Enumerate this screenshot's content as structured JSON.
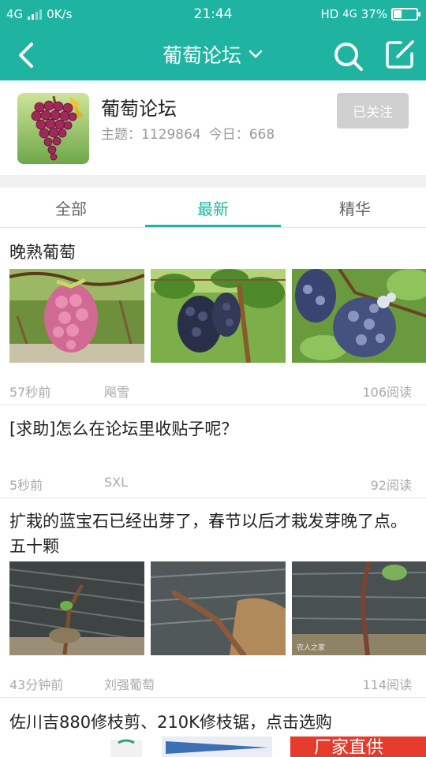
{
  "status_bar": {
    "carrier": "4G",
    "speed": "0K/s",
    "time": "21:44",
    "hd": "HD",
    "network": "4G",
    "battery": "37%",
    "battery_level": 0.37
  },
  "app_bar": {
    "title": "葡萄论坛",
    "icons": [
      "back-icon",
      "chevron-down-icon",
      "search-icon",
      "compose-icon"
    ]
  },
  "forum": {
    "name": "葡萄论坛",
    "topics_label": "主题：1129864",
    "today_label": "今日：668",
    "follow_label": "已关注"
  },
  "tabs": [
    {
      "label": "全部",
      "active": false
    },
    {
      "label": "最新",
      "active": true
    },
    {
      "label": "精华",
      "active": false
    }
  ],
  "posts": [
    {
      "title": "晚熟葡萄",
      "images": [
        "pink-grape-cluster",
        "dark-grape-vine",
        "blue-grape-cluster"
      ],
      "time": "57秒前",
      "author": "飚雪",
      "reads": "106阅读"
    },
    {
      "title": "[求助]怎么在论坛里收贴子呢？",
      "images": [],
      "time": "5秒前",
      "author": "SXL",
      "reads": "92阅读"
    },
    {
      "title": "扩栽的蓝宝石已经出芽了，春节以后才栽发芽晚了点。五十颗",
      "images": [
        "seedling-on-film",
        "vine-cutting-soil",
        "sprouting-vine-film"
      ],
      "time": "43分钟前",
      "author": "刘强葡萄",
      "reads": "114阅读"
    }
  ],
  "ad": {
    "title": "佐川吉880修枝剪、210K修枝锯，点击选购",
    "banner_text": "厂家直供"
  },
  "colors": {
    "accent": "#1fb3a2",
    "follow_bg": "#cfcfcf",
    "ad_red": "#e53a2c"
  }
}
